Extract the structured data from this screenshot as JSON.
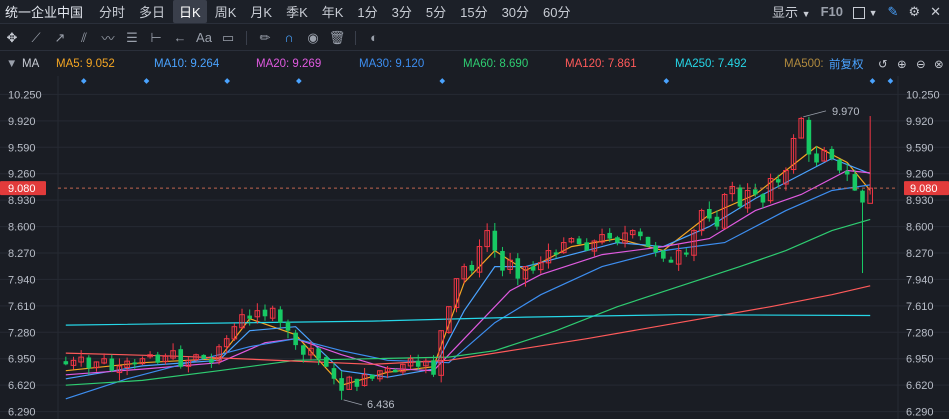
{
  "topbar": {
    "stock_name": "统一企业中国",
    "periods": [
      "分时",
      "多日",
      "日K",
      "周K",
      "月K",
      "季K",
      "年K",
      "1分",
      "3分",
      "5分",
      "15分",
      "30分",
      "60分"
    ],
    "active_period": "日K",
    "display_label": "显示",
    "f10_label": "F10"
  },
  "toolbar": {
    "font_tool_label": "Aa"
  },
  "ma_bar": {
    "label": "MA",
    "items": [
      {
        "text": "MA5: 9.052",
        "color": "#f5a623"
      },
      {
        "text": "MA10: 9.264",
        "color": "#4aa3ff"
      },
      {
        "text": "MA20: 9.269",
        "color": "#e05ae0"
      },
      {
        "text": "MA30: 9.120",
        "color": "#3d8ef0"
      },
      {
        "text": "MA60: 8.690",
        "color": "#2ecc71"
      },
      {
        "text": "MA120: 7.861",
        "color": "#ff5a5a"
      },
      {
        "text": "MA250: 7.492",
        "color": "#26d7e8"
      },
      {
        "text": "MA500:",
        "color": "#b08a3e"
      }
    ],
    "adjust_label": "前复权"
  },
  "chart_data": {
    "type": "candlestick",
    "y_ticks": [
      10.25,
      9.92,
      9.59,
      9.26,
      8.93,
      8.6,
      8.27,
      7.94,
      7.61,
      7.28,
      6.95,
      6.62,
      6.29
    ],
    "ylim": [
      6.26,
      10.38
    ],
    "current_price": "9.080",
    "annotations": [
      {
        "text": "9.970",
        "price": 9.97
      },
      {
        "text": "6.436",
        "price": 6.436
      }
    ],
    "ohlc_open_start": 6.92,
    "ohlc_closes": [
      6.88,
      6.93,
      6.97,
      6.83,
      6.91,
      6.95,
      6.8,
      6.86,
      6.92,
      6.88,
      6.95,
      7.0,
      6.9,
      6.98,
      7.05,
      6.85,
      6.93,
      7.0,
      6.95,
      6.9,
      7.1,
      7.2,
      7.35,
      7.5,
      7.45,
      7.55,
      7.48,
      7.58,
      7.4,
      7.3,
      7.12,
      7.0,
      7.08,
      6.95,
      6.85,
      6.7,
      6.55,
      6.72,
      6.6,
      6.75,
      6.7,
      6.8,
      6.83,
      6.78,
      6.88,
      6.95,
      6.85,
      6.92,
      6.75,
      7.3,
      7.6,
      7.95,
      8.1,
      8.05,
      8.35,
      8.55,
      8.3,
      8.05,
      8.18,
      7.95,
      8.1,
      8.05,
      8.15,
      8.3,
      8.25,
      8.4,
      8.45,
      8.38,
      8.3,
      8.42,
      8.5,
      8.45,
      8.4,
      8.52,
      8.55,
      8.48,
      8.35,
      8.28,
      8.2,
      8.15,
      8.3,
      8.25,
      8.55,
      8.8,
      8.7,
      8.6,
      9.0,
      9.1,
      8.85,
      9.05,
      9.0,
      8.9,
      9.2,
      9.15,
      9.3,
      9.7,
      9.95,
      9.5,
      9.4,
      9.55,
      9.45,
      9.3,
      9.25,
      9.05,
      8.9,
      9.08
    ],
    "ma_series": [
      {
        "name": "MA5",
        "color": "#f5a623",
        "points": [
          [
            0,
            6.8
          ],
          [
            10,
            6.9
          ],
          [
            20,
            6.95
          ],
          [
            24,
            7.45
          ],
          [
            30,
            7.25
          ],
          [
            36,
            6.62
          ],
          [
            42,
            6.78
          ],
          [
            48,
            6.85
          ],
          [
            52,
            7.9
          ],
          [
            56,
            8.3
          ],
          [
            60,
            8.05
          ],
          [
            66,
            8.35
          ],
          [
            72,
            8.45
          ],
          [
            78,
            8.3
          ],
          [
            84,
            8.75
          ],
          [
            90,
            9.0
          ],
          [
            96,
            9.45
          ],
          [
            98,
            9.6
          ],
          [
            102,
            9.4
          ],
          [
            105,
            9.05
          ]
        ]
      },
      {
        "name": "MA10",
        "color": "#4aa3ff",
        "points": [
          [
            0,
            6.7
          ],
          [
            10,
            6.86
          ],
          [
            20,
            6.93
          ],
          [
            24,
            7.3
          ],
          [
            30,
            7.35
          ],
          [
            36,
            6.8
          ],
          [
            42,
            6.72
          ],
          [
            48,
            6.82
          ],
          [
            52,
            7.55
          ],
          [
            56,
            8.1
          ],
          [
            60,
            8.1
          ],
          [
            66,
            8.25
          ],
          [
            72,
            8.4
          ],
          [
            78,
            8.35
          ],
          [
            84,
            8.6
          ],
          [
            90,
            8.95
          ],
          [
            96,
            9.25
          ],
          [
            100,
            9.45
          ],
          [
            105,
            9.26
          ]
        ]
      },
      {
        "name": "MA20",
        "color": "#e05ae0",
        "points": [
          [
            0,
            6.75
          ],
          [
            10,
            6.82
          ],
          [
            20,
            6.9
          ],
          [
            26,
            7.15
          ],
          [
            30,
            7.2
          ],
          [
            36,
            7.0
          ],
          [
            42,
            6.83
          ],
          [
            48,
            6.8
          ],
          [
            52,
            7.2
          ],
          [
            58,
            7.8
          ],
          [
            62,
            8.0
          ],
          [
            70,
            8.25
          ],
          [
            78,
            8.35
          ],
          [
            84,
            8.45
          ],
          [
            90,
            8.8
          ],
          [
            96,
            9.0
          ],
          [
            102,
            9.3
          ],
          [
            105,
            9.27
          ]
        ]
      },
      {
        "name": "MA30",
        "color": "#3d8ef0",
        "points": [
          [
            0,
            6.45
          ],
          [
            8,
            6.7
          ],
          [
            16,
            6.9
          ],
          [
            24,
            7.1
          ],
          [
            30,
            7.2
          ],
          [
            36,
            7.05
          ],
          [
            42,
            6.93
          ],
          [
            50,
            6.9
          ],
          [
            56,
            7.4
          ],
          [
            62,
            7.75
          ],
          [
            70,
            8.1
          ],
          [
            78,
            8.3
          ],
          [
            86,
            8.4
          ],
          [
            94,
            8.8
          ],
          [
            100,
            9.05
          ],
          [
            105,
            9.12
          ]
        ]
      },
      {
        "name": "MA60",
        "color": "#2ecc71",
        "points": [
          [
            0,
            6.62
          ],
          [
            10,
            6.68
          ],
          [
            20,
            6.8
          ],
          [
            30,
            6.93
          ],
          [
            40,
            6.95
          ],
          [
            50,
            6.97
          ],
          [
            56,
            7.05
          ],
          [
            64,
            7.3
          ],
          [
            72,
            7.6
          ],
          [
            80,
            7.85
          ],
          [
            88,
            8.1
          ],
          [
            94,
            8.3
          ],
          [
            100,
            8.55
          ],
          [
            105,
            8.69
          ]
        ]
      },
      {
        "name": "MA120",
        "color": "#ff5a5a",
        "points": [
          [
            0,
            7.02
          ],
          [
            15,
            6.98
          ],
          [
            30,
            6.92
          ],
          [
            40,
            6.88
          ],
          [
            50,
            6.93
          ],
          [
            58,
            7.05
          ],
          [
            68,
            7.2
          ],
          [
            80,
            7.4
          ],
          [
            92,
            7.6
          ],
          [
            100,
            7.75
          ],
          [
            105,
            7.86
          ]
        ]
      },
      {
        "name": "MA250",
        "color": "#26d7e8",
        "points": [
          [
            0,
            7.37
          ],
          [
            40,
            7.42
          ],
          [
            60,
            7.47
          ],
          [
            80,
            7.5
          ],
          [
            105,
            7.49
          ]
        ]
      }
    ]
  },
  "colors": {
    "up": "#f23645",
    "down": "#17c964",
    "background": "#1a1d24",
    "accent": "#4aa3ff",
    "current_price_bg": "#e23b3b"
  },
  "icons": {
    "toolbar": [
      "cursor-icon",
      "line-icon",
      "ray-icon",
      "channel-icon",
      "wave-icon",
      "fib-icon",
      "range-icon",
      "arrow-icon",
      "text-icon",
      "comment-icon",
      "brush-icon",
      "magnet-icon",
      "eye-icon",
      "trash-icon",
      "toggle-icon"
    ],
    "topbar_right": [
      "square-icon",
      "pen-icon",
      "settings-icon",
      "close-icon"
    ],
    "ma_bar_right": [
      "undo-icon",
      "zoom-in-icon",
      "zoom-out-icon",
      "close-icon"
    ]
  }
}
